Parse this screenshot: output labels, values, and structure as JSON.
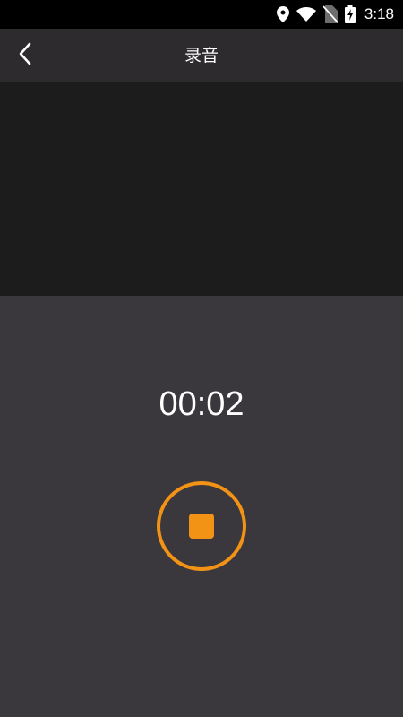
{
  "status_bar": {
    "time": "3:18",
    "icons": [
      "location-icon",
      "wifi-icon",
      "no-sim-icon",
      "battery-charging-icon"
    ]
  },
  "header": {
    "title": "录音",
    "back_icon": "chevron-left-icon"
  },
  "recorder": {
    "elapsed": "00:02",
    "stop_icon": "stop-icon"
  },
  "colors": {
    "accent": "#f39316",
    "app_bar": "#2d2b2e",
    "preview_bg": "#1c1c1c",
    "page_bg": "#3b383d",
    "status_bar": "#000000"
  }
}
